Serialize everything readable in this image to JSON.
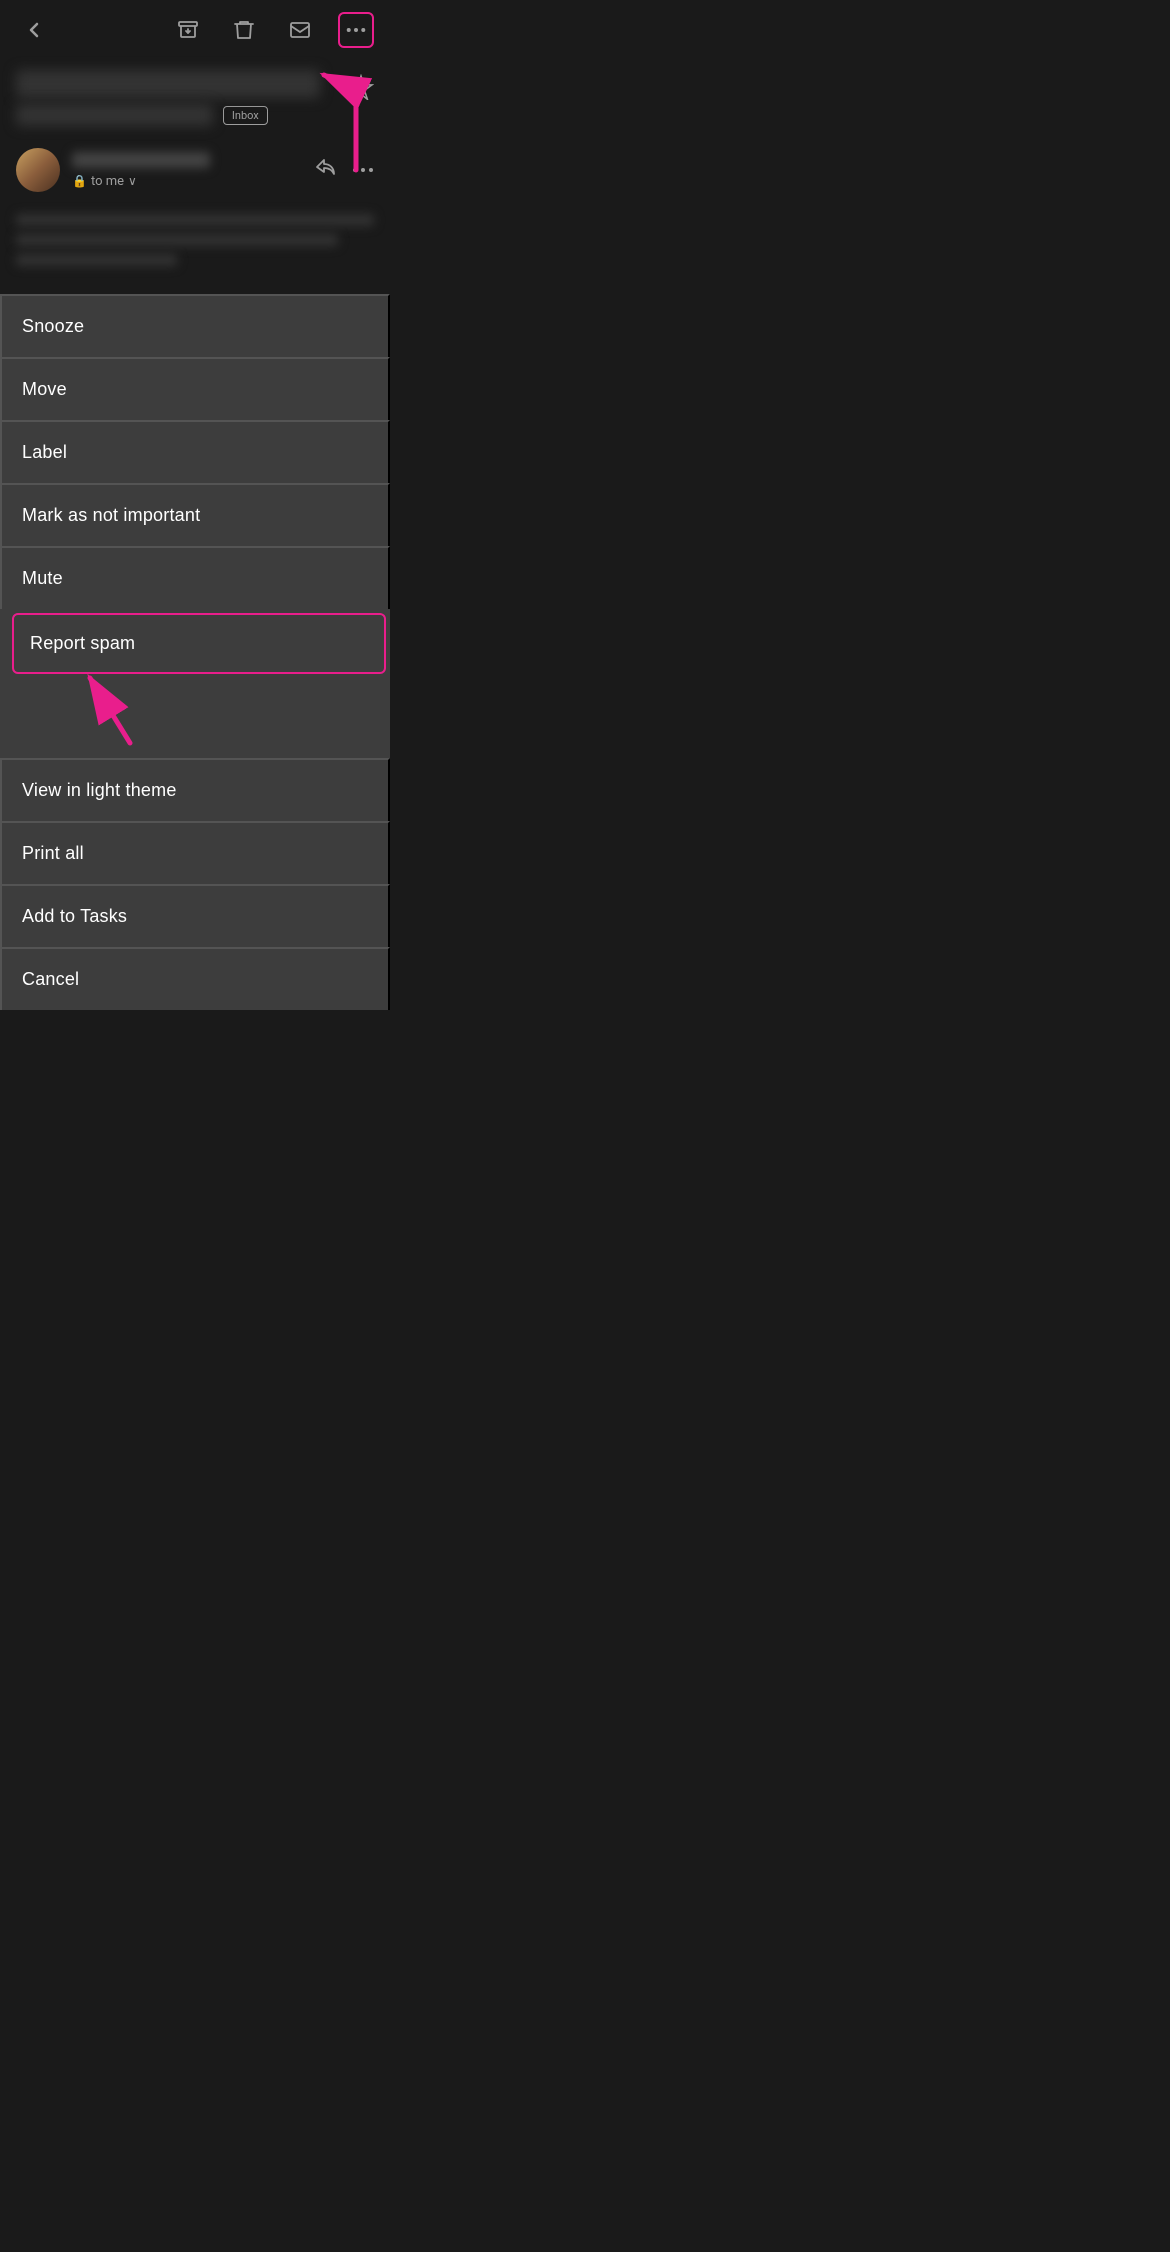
{
  "toolbar": {
    "back_icon": "‹",
    "archive_icon": "⬇",
    "delete_icon": "🗑",
    "mail_icon": "✉",
    "more_icon": "•••"
  },
  "email": {
    "inbox_badge": "Inbox",
    "to_me_label": "to me",
    "chevron": "›"
  },
  "menu": {
    "items": [
      {
        "id": "snooze",
        "label": "Snooze"
      },
      {
        "id": "move",
        "label": "Move"
      },
      {
        "id": "label",
        "label": "Label"
      },
      {
        "id": "mark-not-important",
        "label": "Mark as not important"
      },
      {
        "id": "mute",
        "label": "Mute"
      },
      {
        "id": "report-spam",
        "label": "Report spam"
      },
      {
        "id": "view-light-theme",
        "label": "View in light theme"
      },
      {
        "id": "print-all",
        "label": "Print all"
      },
      {
        "id": "add-to-tasks",
        "label": "Add to Tasks"
      },
      {
        "id": "cancel",
        "label": "Cancel"
      }
    ]
  }
}
